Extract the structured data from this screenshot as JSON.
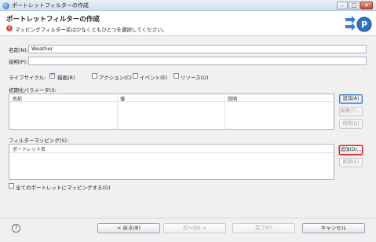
{
  "window": {
    "title": "ポートレットフィルターの作成",
    "controls": {
      "minimize": "–",
      "maximize": "□",
      "close": "✕"
    }
  },
  "header": {
    "title": "ポートレットフィルターの作成",
    "error_message": "マッピングフィルター名は少なくともひとつを選択してください。",
    "error_icon": "error-icon",
    "logo_letter": "P"
  },
  "form": {
    "name_label": "名前(N):",
    "name_value": "Weather",
    "description_label": "説明(P):",
    "description_value": "",
    "lifecycle_label": "ライフサイクル:",
    "lifecycle_options": [
      {
        "label": "描画(R)",
        "checked": true
      },
      {
        "label": "アクション(C)",
        "checked": false
      },
      {
        "label": "イベント(E)",
        "checked": false
      },
      {
        "label": "リソース(U)",
        "checked": false
      }
    ]
  },
  "init_params": {
    "label": "初期化パラメータ(I):",
    "columns": [
      "名前",
      "値",
      "説明"
    ],
    "rows": [],
    "buttons": {
      "add": "追加(A)",
      "edit": "編集(T)...",
      "remove": "削除(D)"
    }
  },
  "filter_mapping": {
    "label": "フィルターマッピング(S):",
    "columns": [
      "ポートレット名"
    ],
    "rows": [],
    "buttons": {
      "add": "追加(D)...",
      "remove": "削除(E)"
    },
    "map_all_label": "全てのポートレットにマッピングする(G)",
    "map_all_checked": false
  },
  "footer": {
    "help_glyph": "?",
    "back": "< 戻る(B)",
    "next": "次へ(N) >",
    "finish": "完了(F)",
    "cancel": "キャンセル"
  }
}
